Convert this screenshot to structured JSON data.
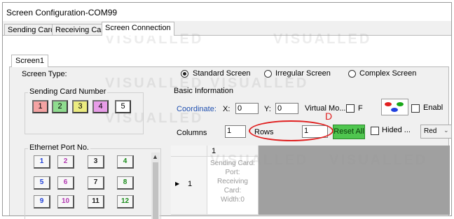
{
  "window": {
    "title": "Screen Configuration-COM99"
  },
  "tabs": [
    {
      "label": "Sending Card"
    },
    {
      "label": "Receiving Card"
    },
    {
      "label": "Screen Connection"
    }
  ],
  "screen_tab": {
    "label": "Screen1"
  },
  "screen_type": {
    "label": "Screen Type:",
    "options": [
      {
        "label": "Standard Screen",
        "selected": true
      },
      {
        "label": "Irregular Screen",
        "selected": false
      },
      {
        "label": "Complex Screen",
        "selected": false
      }
    ]
  },
  "sending_card": {
    "label": "Sending Card Number",
    "buttons": [
      {
        "label": "1",
        "color": "#f4a3a3"
      },
      {
        "label": "2",
        "color": "#8fdc8f"
      },
      {
        "label": "3",
        "color": "#ecec80"
      },
      {
        "label": "4",
        "color": "#e79de7"
      },
      {
        "label": "5",
        "color": "#ffffff"
      }
    ]
  },
  "ethernet": {
    "label": "Ethernet Port No.",
    "ports": [
      {
        "label": "1",
        "color": "#1f3fd8"
      },
      {
        "label": "2",
        "color": "#b23ab2"
      },
      {
        "label": "3",
        "color": "#222222"
      },
      {
        "label": "4",
        "color": "#1b8c1b"
      },
      {
        "label": "5",
        "color": "#1f3fd8"
      },
      {
        "label": "6",
        "color": "#b23ab2"
      },
      {
        "label": "7",
        "color": "#222222"
      },
      {
        "label": "8",
        "color": "#1b8c1b"
      },
      {
        "label": "9",
        "color": "#1f3fd8"
      },
      {
        "label": "10",
        "color": "#b23ab2"
      },
      {
        "label": "11",
        "color": "#222222"
      },
      {
        "label": "12",
        "color": "#1b8c1b"
      }
    ]
  },
  "basic_info": {
    "label": "Basic Information",
    "coordinate_label": "Coordinate:",
    "x_label": "X:",
    "x_value": "0",
    "y_label": "Y:",
    "y_value": "0",
    "virtual_label": "Virtual Mo...",
    "f_label": "F",
    "enable_label": "Enabl",
    "columns_label": "Columns",
    "columns_value": "1",
    "rows_label": "Rows",
    "rows_value": "1",
    "reset_label": "Reset All",
    "hided_label": "Hided ...",
    "color_select": "Red",
    "annotation_letter": "D"
  },
  "grid": {
    "column_header": "1",
    "row_header": "1",
    "cell_text": [
      "Sending Card:",
      "Port:",
      "Receiving",
      "Card:",
      "Width:0"
    ]
  },
  "watermark": "VISUALLED",
  "colors": {
    "reset_button": "#4fc64f",
    "annotation": "#e02020",
    "coordinate_label": "#2050b0"
  }
}
